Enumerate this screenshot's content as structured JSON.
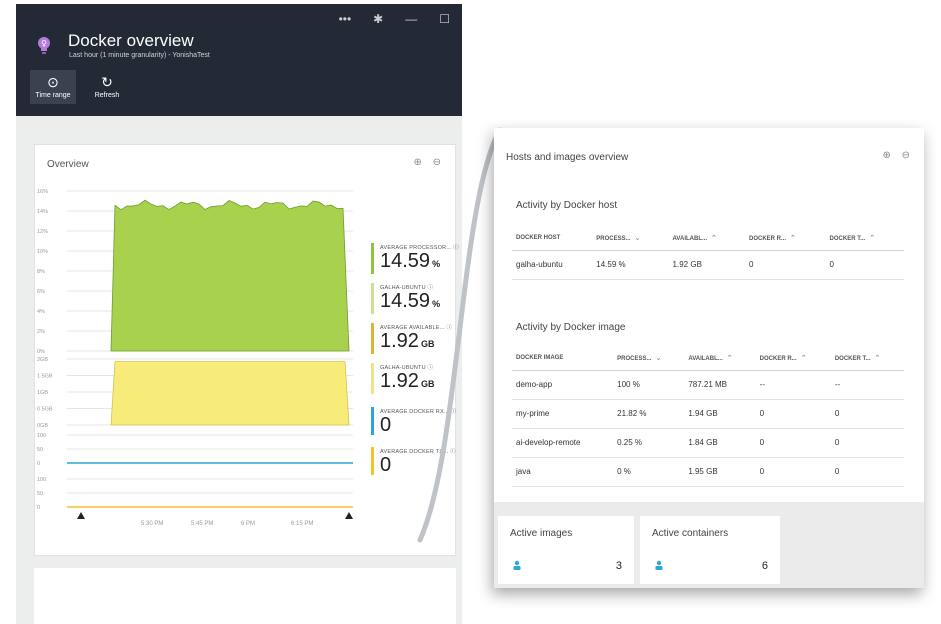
{
  "header": {
    "title": "Docker overview",
    "subtitle": "Last hour (1 minute granularity) - YonishaTest",
    "window_controls": [
      "•••",
      "✱",
      "—",
      "☐"
    ],
    "toolbar": [
      {
        "label": "Time range",
        "icon": "clock-icon",
        "glyph": "⊙"
      },
      {
        "label": "Refresh",
        "icon": "refresh-icon",
        "glyph": "↻"
      }
    ]
  },
  "overview": {
    "title": "Overview",
    "zoom_icons": [
      "zoom-in-icon",
      "zoom-out-icon"
    ],
    "zoom_glyphs": "⊕ ⊖"
  },
  "chart_data": [
    {
      "type": "area",
      "title": "",
      "y_ticks": [
        "16%",
        "14%",
        "12%",
        "10%",
        "8%",
        "6%",
        "4%",
        "2%",
        "0%"
      ],
      "ylim": [
        0,
        16
      ],
      "series": [
        {
          "name": "AVERAGE PROCESSOR...",
          "color": "#a8d24e",
          "value_percent": 14.59
        }
      ]
    },
    {
      "type": "area",
      "title": "",
      "y_ticks": [
        "2GB",
        "1.5GB",
        "1GB",
        "0.5GB",
        "0GB"
      ],
      "ylim": [
        0,
        2
      ],
      "series": [
        {
          "name": "AVERAGE AVAILABLE...",
          "color": "#f7ec7a",
          "value_gb": 1.92
        }
      ]
    },
    {
      "type": "line",
      "title": "",
      "y_ticks": [
        "100",
        "50",
        "0"
      ],
      "ylim": [
        0,
        100
      ],
      "series": [
        {
          "name": "AVERAGE DOCKER RX...",
          "color": "#2aa7d8",
          "value": 0
        }
      ]
    },
    {
      "type": "line",
      "title": "",
      "y_ticks": [
        "100",
        "50",
        "0"
      ],
      "ylim": [
        0,
        100
      ],
      "series": [
        {
          "name": "AVERAGE DOCKER TX...",
          "color": "#f5c32c",
          "value": 0
        }
      ]
    }
  ],
  "x_ticks": [
    "5:30 PM",
    "5:45 PM",
    "6 PM",
    "6:15 PM"
  ],
  "metrics": [
    {
      "label": "AVERAGE PROCESSOR...",
      "value": "14.59",
      "unit": "%",
      "color": "#8cc63f"
    },
    {
      "label": "GALHA-UBUNTU",
      "value": "14.59",
      "unit": "%",
      "color": "#c9e38d"
    },
    {
      "label": "AVERAGE AVAILABLE...",
      "value": "1.92",
      "unit": "GB",
      "color": "#e0b531"
    },
    {
      "label": "GALHA-UBUNTU",
      "value": "1.92",
      "unit": "GB",
      "color": "#f3e18a"
    },
    {
      "label": "AVERAGE DOCKER RX...",
      "value": "0",
      "unit": "",
      "color": "#2aa7d8"
    },
    {
      "label": "AVERAGE DOCKER TX...",
      "value": "0",
      "unit": "",
      "color": "#f5c32c"
    }
  ],
  "hosts_panel": {
    "title": "Hosts and images overview",
    "host_section": {
      "title": "Activity by Docker host",
      "columns": [
        "DOCKER HOST",
        "PROCESS...",
        "AVAILABL...",
        "DOCKER R...",
        "DOCKER T..."
      ],
      "rows": [
        [
          "galha-ubuntu",
          "14.59 %",
          "1.92 GB",
          "0",
          "0"
        ]
      ]
    },
    "image_section": {
      "title": "Activity by Docker image",
      "columns": [
        "DOCKER IMAGE",
        "PROCESS...",
        "AVAILABL...",
        "DOCKER R...",
        "DOCKER T..."
      ],
      "rows": [
        [
          "demo-app",
          "100 %",
          "787.21 MB",
          "--",
          "--"
        ],
        [
          "my-prime",
          "21.82 %",
          "1.94 GB",
          "0",
          "0"
        ],
        [
          "ai-develop-remote",
          "0.25 %",
          "1.84 GB",
          "0",
          "0"
        ],
        [
          "java",
          "0 %",
          "1.95 GB",
          "0",
          "0"
        ]
      ]
    },
    "tiles": [
      {
        "label": "Active images",
        "value": "3",
        "icon": "user-icon"
      },
      {
        "label": "Active containers",
        "value": "6",
        "icon": "user-icon"
      }
    ]
  }
}
